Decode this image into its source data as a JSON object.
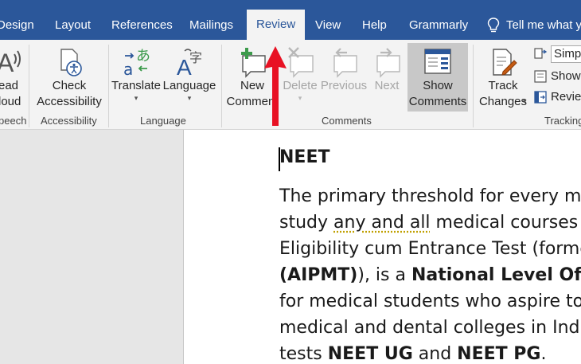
{
  "tabs": [
    {
      "label": "Design"
    },
    {
      "label": "Layout"
    },
    {
      "label": "References"
    },
    {
      "label": "Mailings"
    },
    {
      "label": "Review"
    },
    {
      "label": "View"
    },
    {
      "label": "Help"
    },
    {
      "label": "Grammarly"
    },
    {
      "label": "Tell me what y"
    }
  ],
  "active_tab": "Review",
  "ribbon": {
    "speech": {
      "read_line1": "ead",
      "read_line2": "loud",
      "group_label": "peech"
    },
    "accessibility": {
      "check_line1": "Check",
      "check_line2": "Accessibility",
      "group_label": "Accessibility"
    },
    "language": {
      "translate": "Translate",
      "language": "Language",
      "group_label": "Language"
    },
    "comments": {
      "new_line1": "New",
      "new_line2": "Comment",
      "delete": "Delete",
      "previous": "Previous",
      "next": "Next",
      "show_line1": "Show",
      "show_line2": "Comments",
      "group_label": "Comments"
    },
    "tracking": {
      "track_line1": "Track",
      "track_line2": "Changes",
      "simple": "Simp",
      "show": "Show",
      "review": "Revie",
      "group_label": "Tracking"
    }
  },
  "document": {
    "heading": "NEET",
    "lines": [
      {
        "parts": [
          {
            "t": "The primary threshold for every me",
            "b": false
          }
        ]
      },
      {
        "parts": [
          {
            "t": "study ",
            "b": false
          },
          {
            "t": "any and all",
            "b": false,
            "sq": true
          },
          {
            "t": " medical courses in",
            "b": false
          }
        ]
      },
      {
        "parts": [
          {
            "t": "Eligibility cum Entrance Test (forme",
            "b": false
          }
        ]
      },
      {
        "parts": [
          {
            "t": "(AIPMT)",
            "b": true
          },
          {
            "t": "), is a ",
            "b": false
          },
          {
            "t": "National Level Offlin",
            "b": true
          }
        ]
      },
      {
        "parts": [
          {
            "t": "for medical students who aspire to",
            "b": false
          }
        ]
      },
      {
        "parts": [
          {
            "t": "medical and dental colleges in India",
            "b": false
          }
        ]
      },
      {
        "parts": [
          {
            "t": "tests ",
            "b": false
          },
          {
            "t": "NEET UG",
            "b": true
          },
          {
            "t": " and ",
            "b": false
          },
          {
            "t": "NEET PG",
            "b": true
          },
          {
            "t": ".",
            "b": false
          }
        ]
      }
    ]
  },
  "colors": {
    "title_bar": "#2b579a",
    "ribbon": "#f3f3f3",
    "arrow": "#e81123",
    "add_green": "#3c9a4b"
  }
}
